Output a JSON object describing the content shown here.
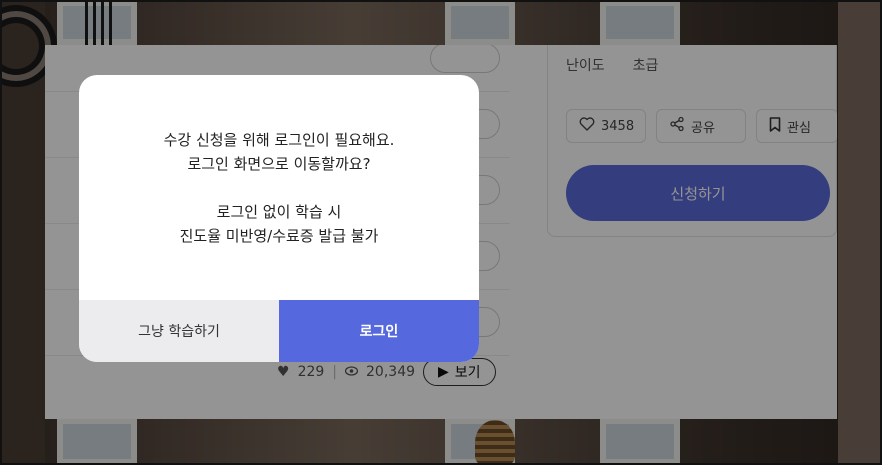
{
  "course_panel": {
    "difficulty_label": "난이도",
    "difficulty_value": "초급",
    "like_count": "3458",
    "share_label": "공유",
    "bookmark_label": "관심",
    "apply_label": "신청하기",
    "lesson_stats": {
      "likes": "229",
      "views": "20,349",
      "view_button_label": "보기"
    }
  },
  "modal": {
    "line1": "수강 신청을 위해 로그인이 필요해요.",
    "line2": "로그인 화면으로 이동할까요?",
    "line3": "로그인 없이 학습 시",
    "line4": "진도율 미반영/수료증 발급 불가",
    "skip_button": "그냥 학습하기",
    "login_button": "로그인"
  },
  "colors": {
    "primary": "#5568dd",
    "secondary_button_bg": "#ececef"
  },
  "icons": {
    "like": "heart-outline-icon",
    "share": "share-icon",
    "bookmark": "bookmark-icon",
    "lesson_like": "heart-filled-icon",
    "views": "eye-icon",
    "play": "play-icon"
  }
}
